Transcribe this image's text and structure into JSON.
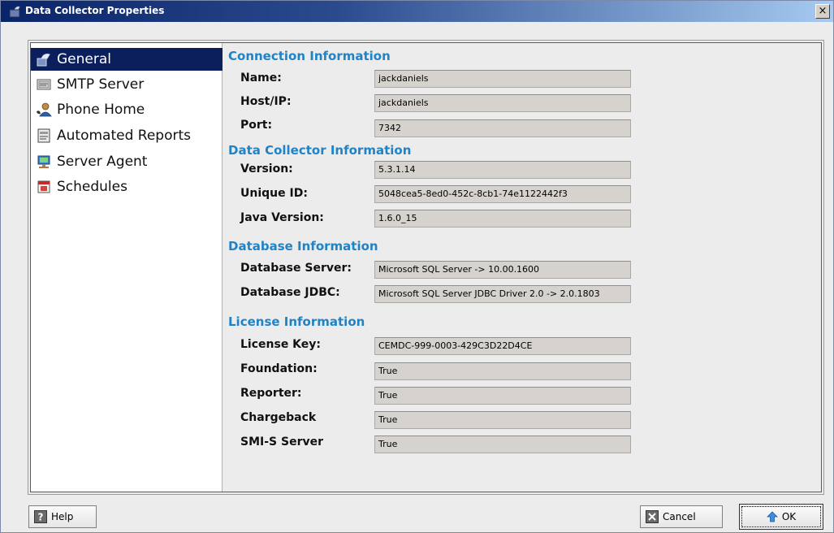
{
  "window": {
    "title": "Data Collector Properties",
    "close_glyph": "×"
  },
  "sidebar": {
    "items": [
      {
        "label": "General",
        "icon": "wrench-icon",
        "selected": true
      },
      {
        "label": "SMTP Server",
        "icon": "mail-icon",
        "selected": false
      },
      {
        "label": "Phone Home",
        "icon": "person-phone-icon",
        "selected": false
      },
      {
        "label": "Automated Reports",
        "icon": "report-icon",
        "selected": false
      },
      {
        "label": "Server Agent",
        "icon": "server-agent-icon",
        "selected": false
      },
      {
        "label": "Schedules",
        "icon": "calendar-icon",
        "selected": false
      }
    ]
  },
  "sections": {
    "connection": {
      "title": "Connection Information",
      "fields": [
        {
          "label": "Name:",
          "value": "jackdaniels"
        },
        {
          "label": "Host/IP:",
          "value": "jackdaniels"
        },
        {
          "label": "Port:",
          "value": "7342"
        }
      ]
    },
    "collector": {
      "title": "Data Collector Information",
      "fields": [
        {
          "label": "Version:",
          "value": "5.3.1.14"
        },
        {
          "label": "Unique ID:",
          "value": "5048cea5-8ed0-452c-8cb1-74e1122442f3"
        },
        {
          "label": "Java Version:",
          "value": "1.6.0_15"
        }
      ]
    },
    "database": {
      "title": "Database Information",
      "fields": [
        {
          "label": "Database Server:",
          "value": "Microsoft SQL Server -> 10.00.1600"
        },
        {
          "label": "Database JDBC:",
          "value": "Microsoft SQL Server JDBC Driver 2.0 -> 2.0.1803"
        }
      ]
    },
    "license": {
      "title": "License Information",
      "fields": [
        {
          "label": "License Key:",
          "value": "CEMDC-999-0003-429C3D22D4CE"
        },
        {
          "label": "Foundation:",
          "value": "True"
        },
        {
          "label": "Reporter:",
          "value": "True"
        },
        {
          "label": "Chargeback",
          "value": "True"
        },
        {
          "label": "SMI-S Server",
          "value": "True"
        }
      ]
    }
  },
  "buttons": {
    "help": {
      "label": "Help",
      "icon": "help-icon"
    },
    "cancel": {
      "label": "Cancel",
      "icon": "cancel-icon"
    },
    "ok": {
      "label": "OK",
      "icon": "ok-arrow-icon"
    }
  },
  "colors": {
    "section_title": "#1f83c6",
    "sidebar_selected_bg": "#0a1f5c",
    "field_bg": "#d6d3ce"
  }
}
